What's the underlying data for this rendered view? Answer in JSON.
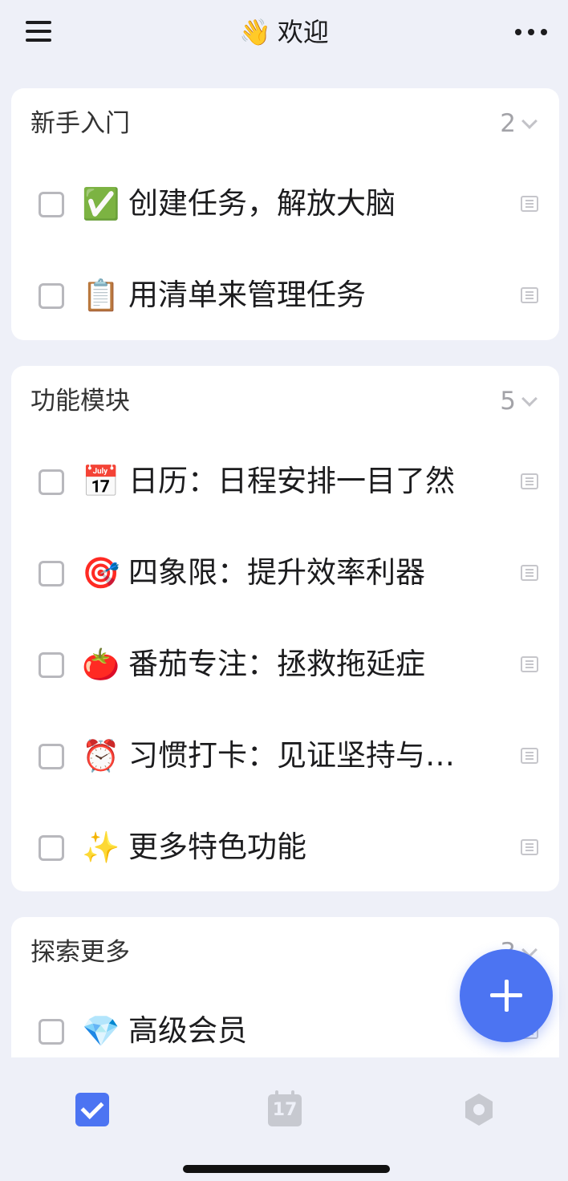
{
  "header": {
    "title_emoji": "👋",
    "title": "欢迎",
    "menu_icon": "hamburger-icon",
    "more_icon": "ellipsis-icon"
  },
  "sections": [
    {
      "title": "新手入门",
      "count": "2",
      "items": [
        {
          "emoji": "✅",
          "label": "创建任务，解放大脑"
        },
        {
          "emoji": "📋",
          "label": "用清单来管理任务"
        }
      ]
    },
    {
      "title": "功能模块",
      "count": "5",
      "items": [
        {
          "emoji": "📅",
          "label": "日历：日程安排一目了然"
        },
        {
          "emoji": "🎯",
          "label": "四象限：提升效率利器"
        },
        {
          "emoji": "🍅",
          "label": "番茄专注：拯救拖延症"
        },
        {
          "emoji": "⏰",
          "label": "习惯打卡：见证坚持与成长"
        },
        {
          "emoji": "✨",
          "label": "更多特色功能"
        }
      ]
    },
    {
      "title": "探索更多",
      "count": "3",
      "items": [
        {
          "emoji": "💎",
          "label": "高级会员"
        }
      ]
    }
  ],
  "tabbar": {
    "calendar_day": "17",
    "tabs": [
      "tasks-tab-icon",
      "calendar-tab-icon",
      "settings-tab-icon"
    ]
  },
  "colors": {
    "accent": "#4c74f2",
    "background": "#eef0f8",
    "card": "#ffffff"
  }
}
